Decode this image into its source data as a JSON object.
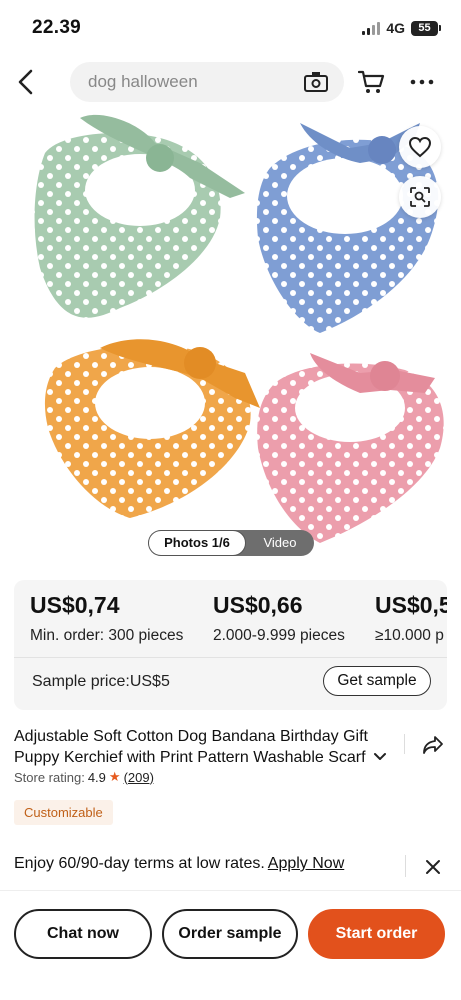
{
  "status_bar": {
    "time": "22.39",
    "network": "4G",
    "battery": "55"
  },
  "header": {
    "search_text": "dog halloween",
    "icons": [
      "back-arrow-icon",
      "camera-icon",
      "cart-icon",
      "more-icon"
    ]
  },
  "gallery": {
    "photos_label": "Photos 1/6",
    "video_label": "Video",
    "product_colors": [
      "#a8cbb0",
      "#7f9ed4",
      "#f0a64a",
      "#ec9eac"
    ]
  },
  "pricing": {
    "tiers": [
      {
        "price": "US$0,74",
        "quantity": "Min. order: 300 pieces"
      },
      {
        "price": "US$0,66",
        "quantity": "2.000-9.999 pieces"
      },
      {
        "price": "US$0,5",
        "quantity": "≥10.000 p"
      }
    ],
    "sample_price": "Sample price:US$5",
    "get_sample_label": "Get sample"
  },
  "product": {
    "title": "Adjustable Soft Cotton Dog Bandana Birthday Gift Puppy Kerchief with Print Pattern Washable Scarf fo",
    "store_rating_label": "Store rating:",
    "store_rating_value": "4.9",
    "review_count": "(209)",
    "badge": "Customizable"
  },
  "finance_banner": {
    "text": "Enjoy 60/90-day terms at low rates.",
    "link": "Apply Now"
  },
  "actions": {
    "chat": "Chat now",
    "order_sample": "Order sample",
    "start_order": "Start order"
  },
  "colors": {
    "accent": "#e2511c",
    "badge_text": "#c06018",
    "badge_bg": "#fbf1e9"
  }
}
